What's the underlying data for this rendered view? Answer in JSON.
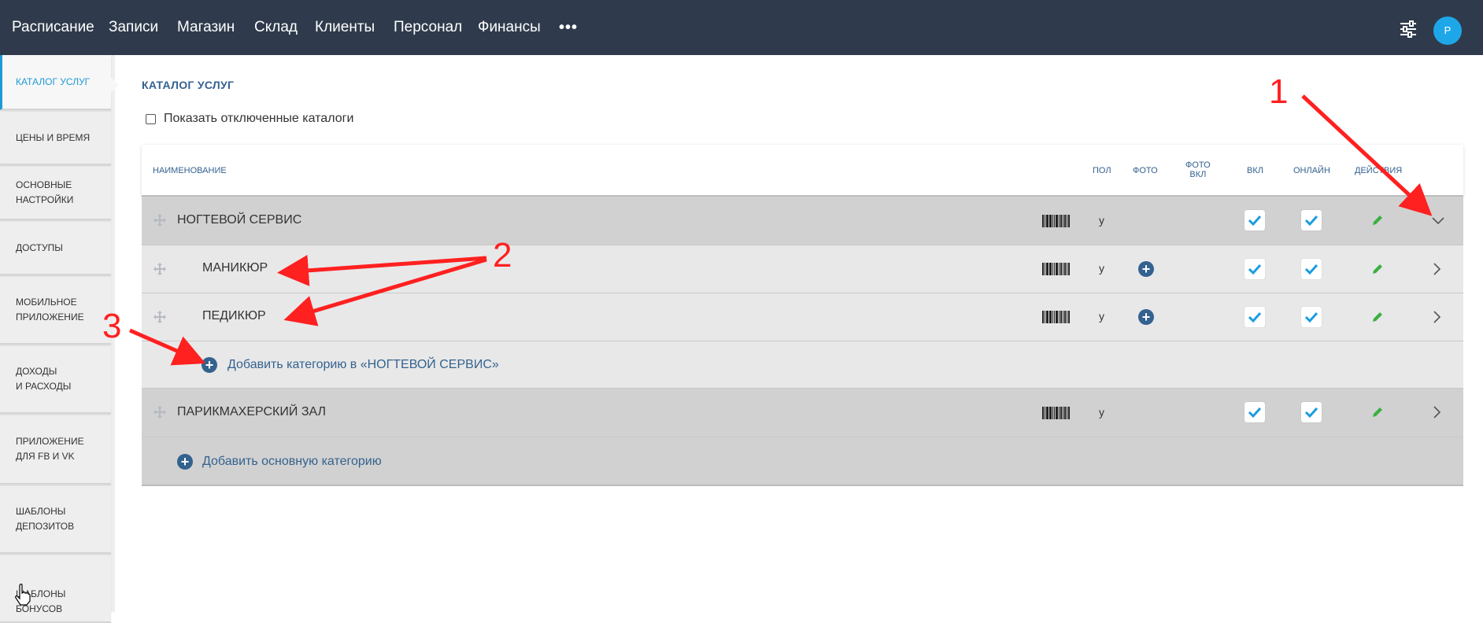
{
  "topnav": {
    "items": [
      "Расписание",
      "Записи",
      "Магазин",
      "Склад",
      "Клиенты",
      "Персонал",
      "Финансы"
    ],
    "more": "•••",
    "avatar_letter": "P"
  },
  "sidebar": {
    "items": [
      {
        "line1": "КАТАЛОГ УСЛУГ",
        "line2": ""
      },
      {
        "line1": "ЦЕНЫ И ВРЕМЯ",
        "line2": ""
      },
      {
        "line1": "ОСНОВНЫЕ",
        "line2": "НАСТРОЙКИ"
      },
      {
        "line1": "ДОСТУПЫ",
        "line2": ""
      },
      {
        "line1": "МОБИЛЬНОЕ",
        "line2": "ПРИЛОЖЕНИЕ"
      },
      {
        "line1": "ДОХОДЫ",
        "line2": "И РАСХОДЫ"
      },
      {
        "line1": "ПРИЛОЖЕНИЕ",
        "line2": "ДЛЯ FB И VK"
      },
      {
        "line1": "ШАБЛОНЫ",
        "line2": "ДЕПОЗИТОВ"
      },
      {
        "line1": "ШАБЛОНЫ",
        "line2": "БОНУСОВ"
      }
    ]
  },
  "main": {
    "title": "КАТАЛОГ УСЛУГ",
    "show_disabled_label": "Показать отключенные каталоги",
    "columns": {
      "name": "НАИМЕНОВАНИЕ",
      "gender": "ПОЛ",
      "photo": "ФОТО",
      "photo_on_1": "ФОТО",
      "photo_on_2": "ВКЛ",
      "enabled": "ВКЛ",
      "online": "ОНЛАЙН",
      "actions": "ДЕЙСТВИЯ"
    },
    "rows": [
      {
        "name": "НОГТЕВОЙ СЕРВИС",
        "gender": "у"
      },
      {
        "name": "МАНИКЮР",
        "gender": "у"
      },
      {
        "name": "ПЕДИКЮР",
        "gender": "у"
      },
      {
        "add_label": "Добавить категорию в «НОГТЕВОЙ СЕРВИС»"
      },
      {
        "name": "ПАРИКМАХЕРСКИЙ ЗАЛ",
        "gender": "у"
      },
      {
        "add_label": "Добавить основную категорию"
      }
    ]
  },
  "annotations": [
    "1",
    "2",
    "3"
  ],
  "colors": {
    "topbar": "#2f3b4c",
    "accent": "#34628f",
    "active_sidebar": "#1f9ad6",
    "check": "#1a9ce0",
    "pencil": "#3cb043",
    "annotation": "#ff2020"
  }
}
